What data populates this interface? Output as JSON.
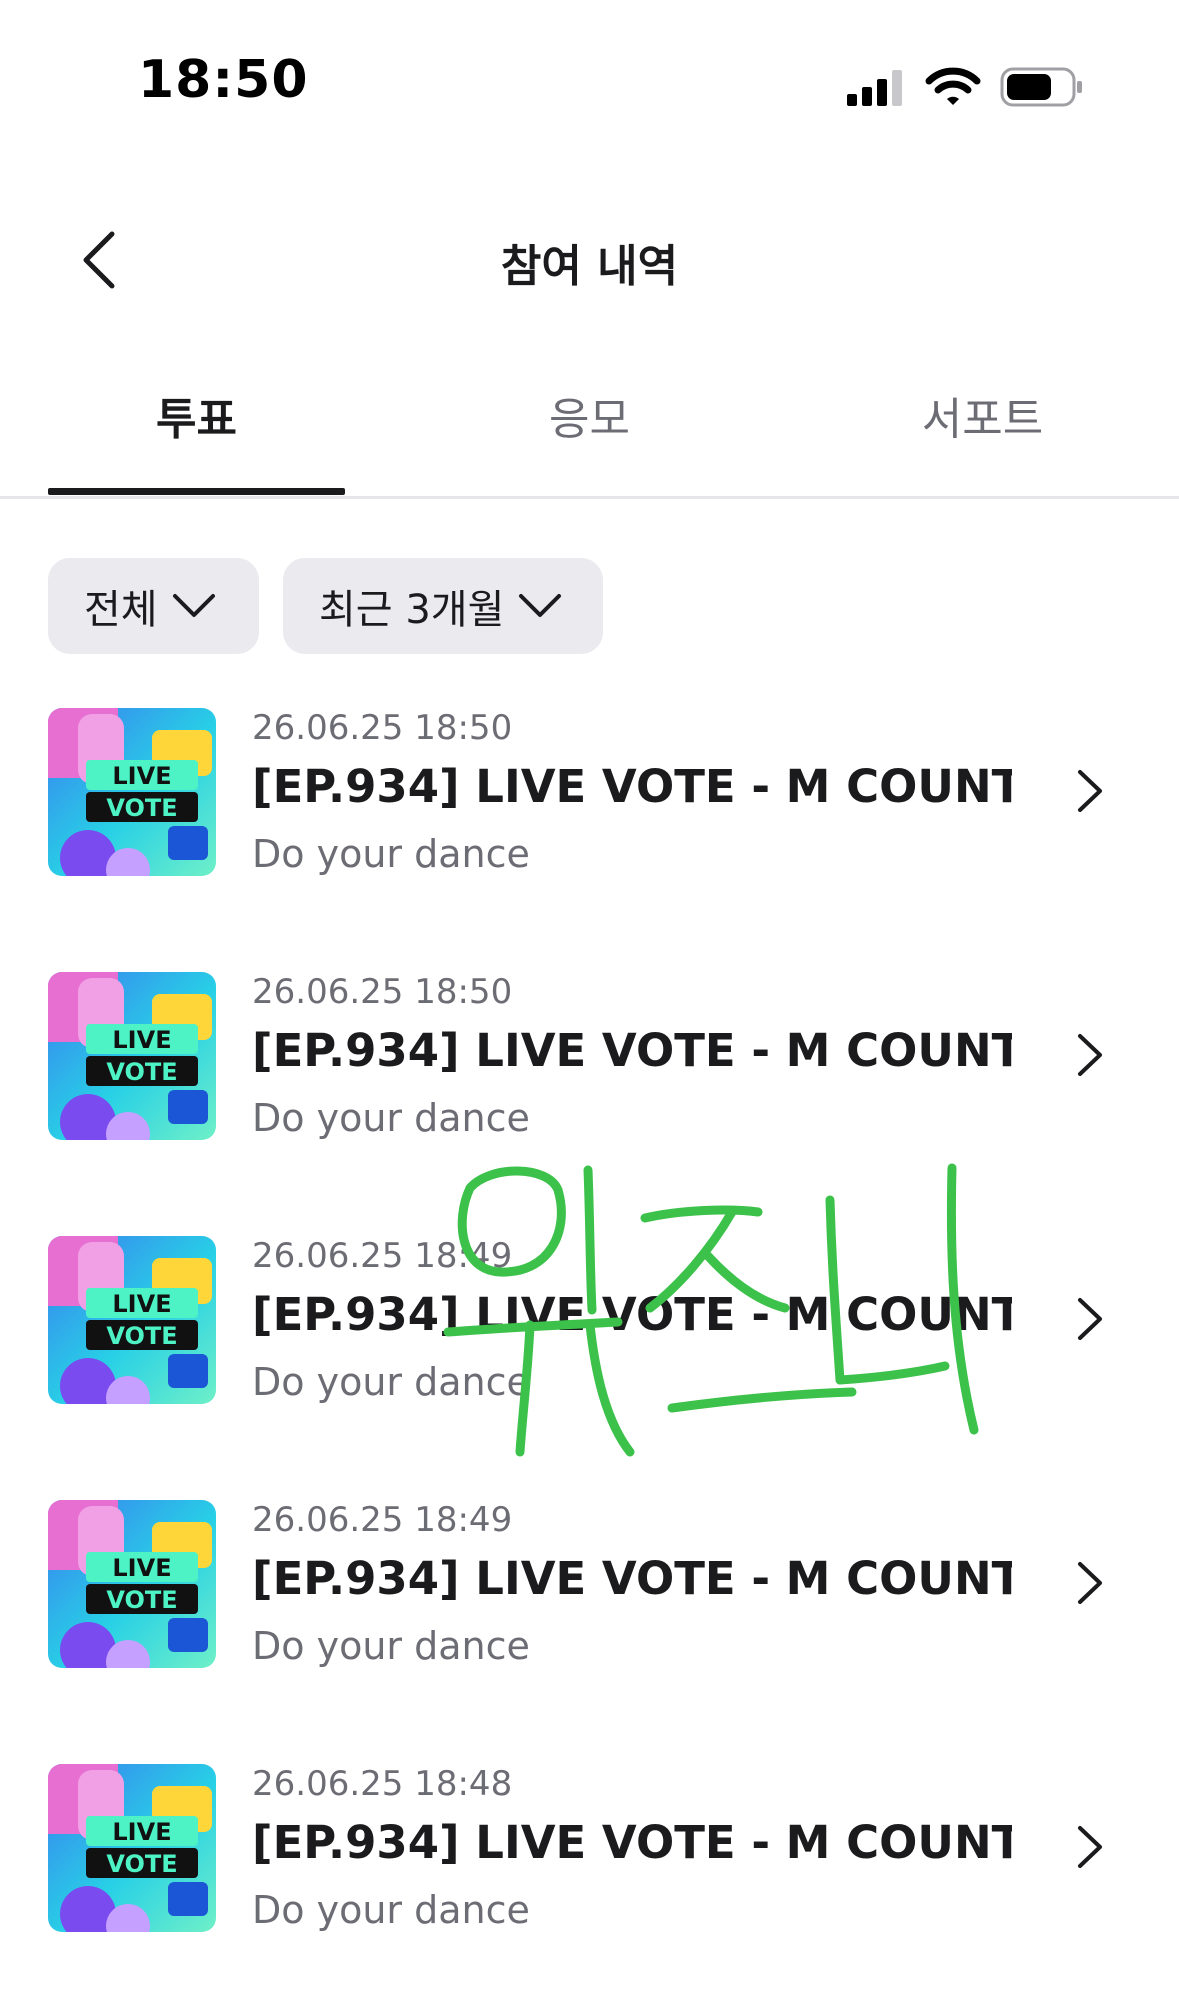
{
  "status_bar": {
    "time": "18:50"
  },
  "header": {
    "title": "참여 내역",
    "back_icon": "chevron-left-icon"
  },
  "tabs": [
    {
      "label": "투표",
      "active": true
    },
    {
      "label": "응모",
      "active": false
    },
    {
      "label": "서포트",
      "active": false
    }
  ],
  "filters": {
    "category": "전체",
    "period": "최근 3개월"
  },
  "items": [
    {
      "date": "26.06.25 18:50",
      "title": "[EP.934] LIVE VOTE - M COUNT...",
      "subtitle": "Do your dance"
    },
    {
      "date": "26.06.25 18:50",
      "title": "[EP.934] LIVE VOTE - M COUNT...",
      "subtitle": "Do your dance"
    },
    {
      "date": "26.06.25 18:49",
      "title": "[EP.934] LIVE VOTE - M COUNT...",
      "subtitle": "Do your dance"
    },
    {
      "date": "26.06.25 18:49",
      "title": "[EP.934] LIVE VOTE - M COUNT...",
      "subtitle": "Do your dance"
    },
    {
      "date": "26.06.25 18:48",
      "title": "[EP.934] LIVE VOTE - M COUNT...",
      "subtitle": "Do your dance"
    }
  ],
  "thumbnail": {
    "line1": "LIVE",
    "line2": "VOTE"
  },
  "overlay": {
    "handwriting_color": "#3cc24a"
  },
  "colors": {
    "text_primary": "#1b1b1e",
    "text_secondary": "#6c6c74",
    "chip_bg": "#eaeaef"
  }
}
